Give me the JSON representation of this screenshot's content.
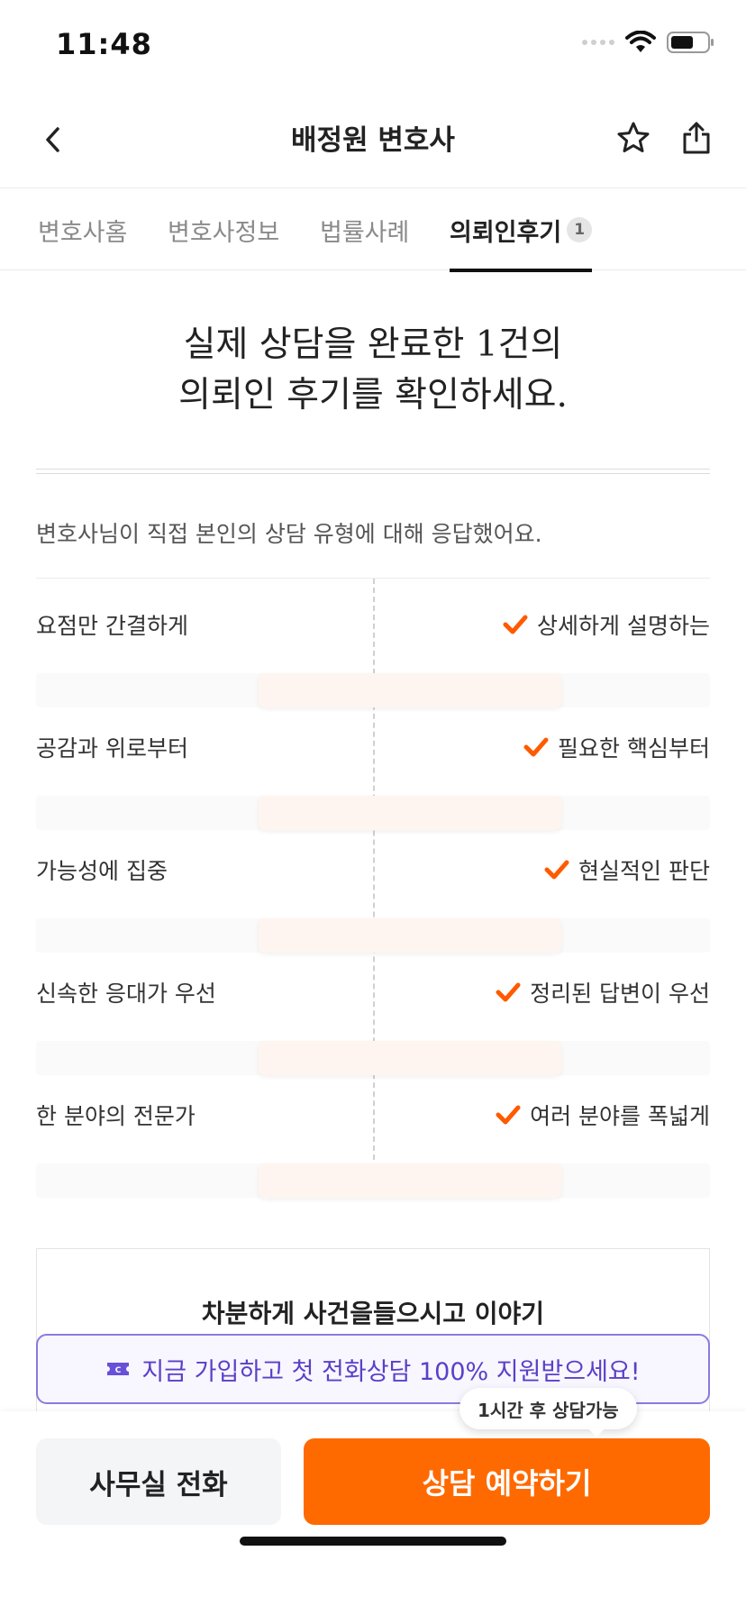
{
  "status_bar": {
    "time": "11:48"
  },
  "nav": {
    "title": "배정원 변호사"
  },
  "tabs": [
    {
      "label": "변호사홈"
    },
    {
      "label": "변호사정보"
    },
    {
      "label": "법률사례"
    },
    {
      "label": "의뢰인후기",
      "badge": "1"
    }
  ],
  "headline": {
    "line1": "실제 상담을 완료한 1건의",
    "line2": "의뢰인 후기를 확인하세요."
  },
  "consult_type": {
    "intro": "변호사님이 직접 본인의 상담 유형에 대해 응답했어요.",
    "traits": [
      {
        "left": "요점만 간결하게",
        "right": "상세하게 설명하는",
        "selected": "right"
      },
      {
        "left": "공감과 위로부터",
        "right": "필요한 핵심부터",
        "selected": "right"
      },
      {
        "left": "가능성에 집중",
        "right": "현실적인 판단",
        "selected": "right"
      },
      {
        "left": "신속한 응대가 우선",
        "right": "정리된 답변이 우선",
        "selected": "right"
      },
      {
        "left": "한 분야의 전문가",
        "right": "여러 분야를 폭넓게",
        "selected": "right"
      }
    ]
  },
  "review": {
    "title": "차분하게 사건을들으시고 이야기"
  },
  "promo": {
    "text": "지금 가입하고 첫 전화상담 100% 지원받으세요!"
  },
  "bottom": {
    "office_call_label": "사무실 전화",
    "book_label": "상담 예약하기",
    "availability": "1시간 후 상담가능"
  },
  "colors": {
    "accent": "#ff6a00",
    "promo": "#5a40c8",
    "check": "#ff5a00"
  }
}
